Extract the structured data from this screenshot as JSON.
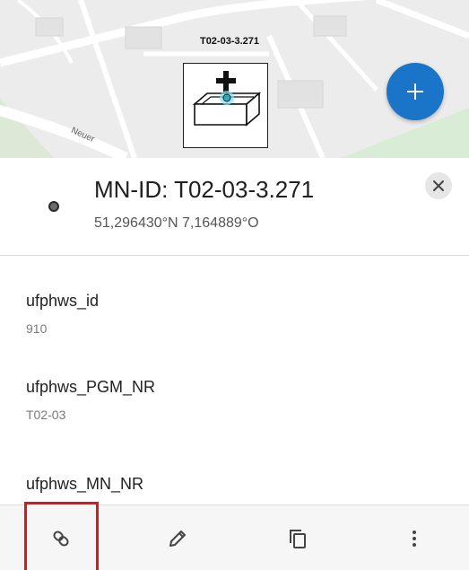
{
  "map": {
    "point_label": "T02-03-3.271",
    "street_label": "Neuer",
    "fab_icon": "plus-icon",
    "marker_icon": "add-manhole-symbol-icon"
  },
  "feature": {
    "title": "MN-ID: T02-03-3.271",
    "coordinates": "51,296430°N  7,164889°O",
    "close_icon": "close-icon"
  },
  "attributes": [
    {
      "name": "ufphws_id",
      "value": "910"
    },
    {
      "name": "ufphws_PGM_NR",
      "value": "T02-03"
    },
    {
      "name": "ufphws_MN_NR",
      "value": ""
    }
  ],
  "toolbar": {
    "items": [
      {
        "icon": "link-icon",
        "highlighted": true
      },
      {
        "icon": "pencil-icon"
      },
      {
        "icon": "copy-icon"
      },
      {
        "icon": "more-vertical-icon"
      }
    ]
  },
  "colors": {
    "fab": "#1a74c8",
    "highlight": "#d01c1c",
    "map_background": "#eeeeee",
    "map_roads": "#ffffff",
    "map_park": "#d9ecd6"
  }
}
